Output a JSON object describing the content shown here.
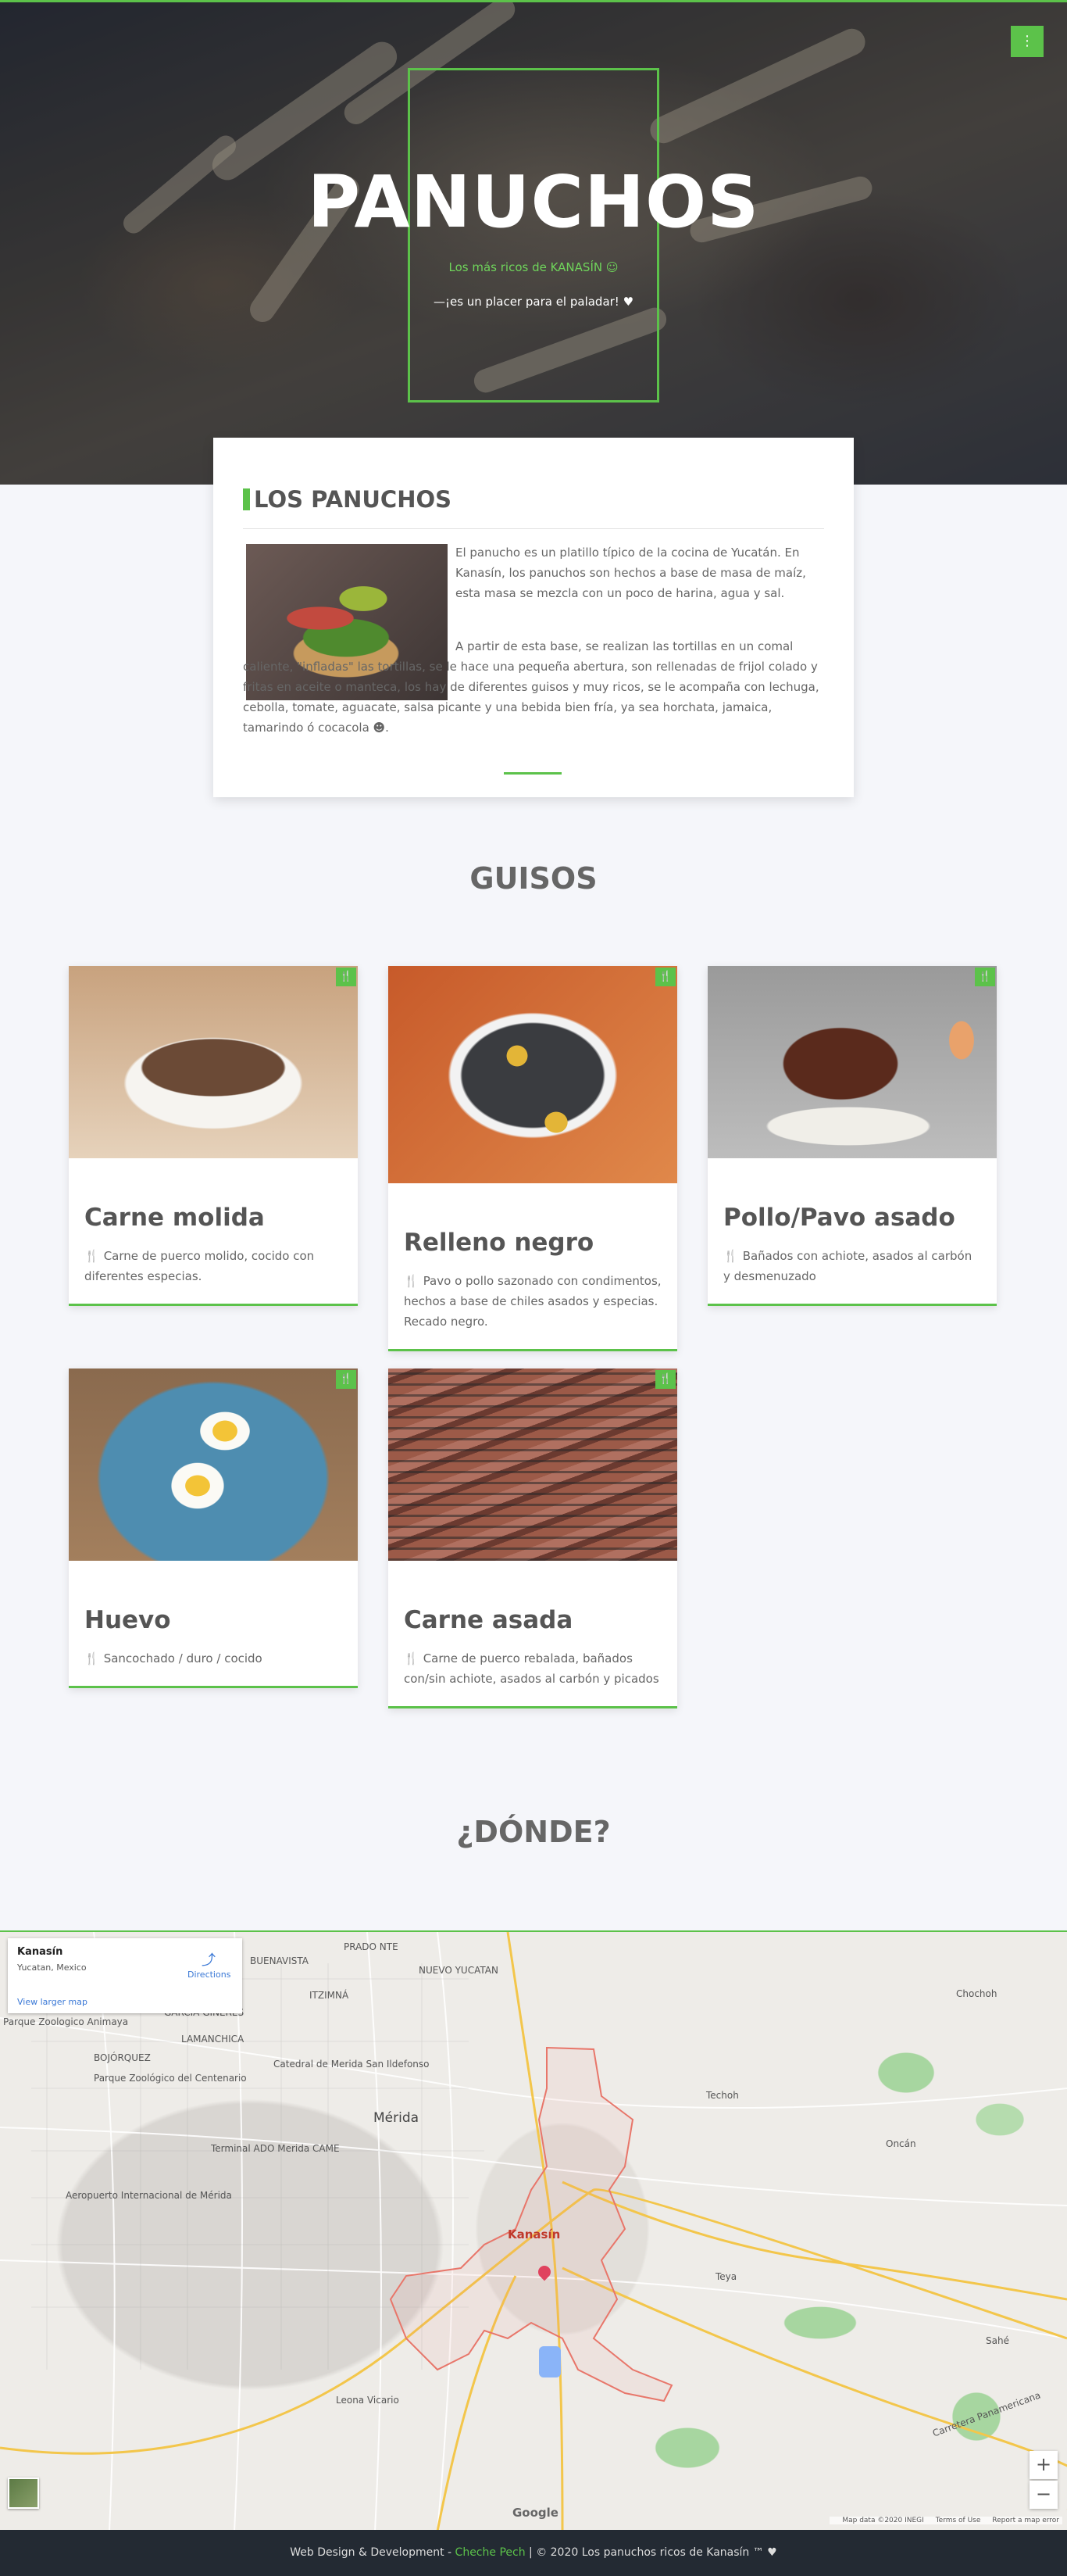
{
  "hero": {
    "title": "PANUCHOS",
    "subtitle": "Los más ricos de KANASÍN ☺",
    "tagline": "—¡es un placer para el paladar! ♥",
    "menu_icon": "⋮"
  },
  "about": {
    "title": "LOS PANUCHOS",
    "paragraph1": "El panucho es un platillo típico de la cocina de Yucatán. En Kanasín, los panuchos son hechos a base de masa de maíz, esta masa se mezcla con un poco de harina, agua y sal.",
    "paragraph2": "A partir de esta base, se realizan las tortillas en un comal caliente, \"infladas\" las tortillas, se le hace una pequeña abertura, son rellenadas de frijol colado y fritas en aceite o manteca, los hay de diferentes guisos y muy ricos, se le acompaña con lechuga, cebolla, tomate, aguacate, salsa picante y una bebida bien fría, ya sea horchata, jamaica, tamarindo ó cocacola ☻."
  },
  "guisos": {
    "title": "GUISOS",
    "card_icon": "🍴",
    "items": [
      {
        "title": "Carne molida",
        "desc": "Carne de puerco molido, cocido con diferentes especias."
      },
      {
        "title": "Relleno negro",
        "desc": "Pavo o pollo sazonado con condimentos, hechos a base de chiles asados y especias. Recado negro."
      },
      {
        "title": "Pollo/Pavo asado",
        "desc": "Bañados con achiote, asados al carbón y desmenuzado"
      },
      {
        "title": "Huevo",
        "desc": "Sancochado / duro / cocido"
      },
      {
        "title": "Carne asada",
        "desc": "Carne de puerco rebalada, bañados con/sin achiote, asados al carbón y picados"
      }
    ]
  },
  "donde": {
    "title": "¿DÓNDE?"
  },
  "map": {
    "place_name": "Kanasín",
    "place_address": "Yucatan, Mexico",
    "directions": "Directions",
    "view_larger": "View larger map",
    "zoom_in": "+",
    "zoom_out": "−",
    "google": "Google",
    "footer_data": "Map data ©2020 INEGI",
    "footer_terms": "Terms of Use",
    "footer_report": "Report a map error",
    "labels": {
      "merida": "Mérida",
      "kanasin": "Kanasín",
      "buenavista": "BUENAVISTA",
      "prado_norte": "PRADO NTE",
      "nuevo_yucatan": "NUEVO YUCATAN",
      "itzimna": "ITZIMNÁ",
      "garcia_gineres": "GARCÍA GINERÉS",
      "bojorquez": "BOJÓRQUEZ",
      "animaya": "Parque Zoologico Animaya",
      "centenario": "Parque Zoológico del Centenario",
      "catedral": "Catedral de Merida San Ildefonso",
      "terminal": "Terminal ADO Merida CAME",
      "aeropuerto": "Aeropuerto Internacional de Mérida",
      "tecoh": "Techoh",
      "oncan": "Oncán",
      "teya": "Teya",
      "chochoh": "Chochoh",
      "sahe": "Sahé",
      "leona_vicario": "Leona Vicario",
      "lamanchica": "LAMANCHICA",
      "panamericana": "Carretera Panamericana"
    }
  },
  "footer": {
    "prefix": "Web Design & Development - ",
    "author": "Cheche Pech",
    "suffix": " | © 2020 Los panuchos ricos de Kanasín ™ ♥"
  }
}
